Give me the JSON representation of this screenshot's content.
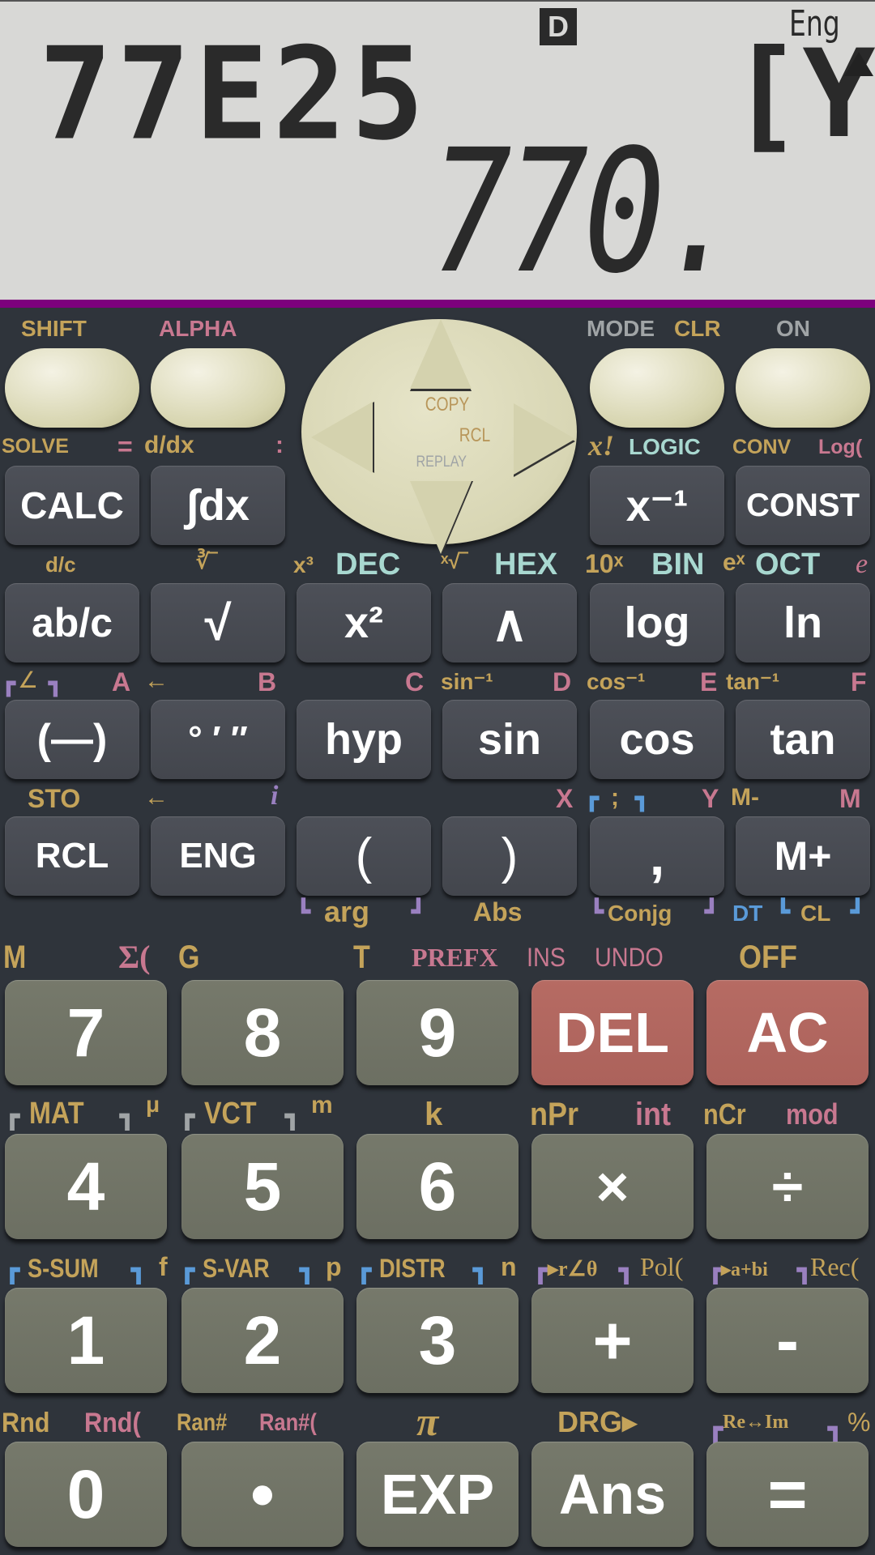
{
  "display": {
    "input_expression": "77E25",
    "variable_indicator": "[Y",
    "scroll_up_indicator": "▲",
    "angle_mode": "D",
    "format_mode": "Eng",
    "result": "770."
  },
  "colors": {
    "background": "#2f343b",
    "display": "#d8d8d6",
    "accent_bar": "#7d007d",
    "shift_text": "#c4a35a",
    "alpha_text": "#c87890",
    "base_text": "#a8d8d0",
    "del_ac_key": "#b0655e"
  },
  "top_row": {
    "shift_label": "SHIFT",
    "alpha_label": "ALPHA",
    "mode_label": "MODE",
    "clr_label": "CLR",
    "on_label": "ON"
  },
  "dpad": {
    "copy_label": "COPY",
    "rcl_label": "RCL",
    "replay_label": "REPLAY"
  },
  "row2": {
    "labels": {
      "solve": "SOLVE",
      "eq": "=",
      "ddx": "d/dx",
      "colon": ":",
      "xfact": "x!",
      "logic": "LOGIC",
      "conv": "CONV",
      "log_paren": "Log("
    },
    "keys": [
      "CALC",
      "∫dx",
      "x⁻¹",
      "CONST"
    ]
  },
  "row3": {
    "labels": {
      "dc": "d/c",
      "cuberoot": "∛‾",
      "x3": "x³",
      "dec": "DEC",
      "xroot": "ˣ√‾",
      "hex": "HEX",
      "tenx": "10ˣ",
      "bin": "BIN",
      "ex": "eˣ",
      "oct": "OCT",
      "e": "e"
    },
    "keys": [
      "ab/c",
      "√",
      "x²",
      "∧",
      "log",
      "ln"
    ]
  },
  "row4": {
    "labels": {
      "angle": "∠",
      "a": "A",
      "left_arrow": "←",
      "b": "B",
      "c": "C",
      "asin": "sin⁻¹",
      "d": "D",
      "acos": "cos⁻¹",
      "e": "E",
      "atan": "tan⁻¹",
      "f": "F"
    },
    "keys": [
      "(—)",
      "° ′ ″",
      "hyp",
      "sin",
      "cos",
      "tan"
    ]
  },
  "row5": {
    "labels": {
      "sto": "STO",
      "left_arrow": "←",
      "i": "i",
      "x": "X",
      "semicolon": ";",
      "y": "Y",
      "mminus": "M-",
      "m": "M"
    },
    "keys": [
      "RCL",
      "ENG",
      "(",
      ")",
      ",",
      "M+"
    ],
    "under_labels": {
      "arg": "arg",
      "abs": "Abs",
      "conjg": "Conjg",
      "dt": "DT",
      "cl": "CL"
    }
  },
  "row6": {
    "labels": {
      "m": "M",
      "sigma": "Σ(",
      "g": "G",
      "t": "T",
      "prefx": "PREFX",
      "ins": "INS",
      "undo": "UNDO",
      "off": "OFF"
    },
    "keys": [
      "7",
      "8",
      "9",
      "DEL",
      "AC"
    ]
  },
  "row7": {
    "labels": {
      "mat": "MAT",
      "mu": "μ",
      "vct": "VCT",
      "milli": "m",
      "k": "k",
      "npr": "nPr",
      "int": "int",
      "ncr": "nCr",
      "mod": "mod"
    },
    "keys": [
      "4",
      "5",
      "6",
      "×",
      "÷"
    ]
  },
  "row8": {
    "labels": {
      "ssum": "S-SUM",
      "f": "f",
      "svar": "S-VAR",
      "p": "p",
      "distr": "DISTR",
      "n": "n",
      "polar": "▸r∠θ",
      "pol": "Pol(",
      "rect": "▸a+bi",
      "rec": "Rec("
    },
    "keys": [
      "1",
      "2",
      "3",
      "+",
      "-"
    ]
  },
  "row9": {
    "labels": {
      "rnd": "Rnd",
      "rnd_paren": "Rnd(",
      "ran": "Ran#",
      "ran_paren": "Ran#(",
      "pi": "π",
      "drg": "DRG▸",
      "reim": "Re↔Im",
      "percent": "%"
    },
    "keys": [
      "0",
      "•",
      "EXP",
      "Ans",
      "="
    ]
  }
}
